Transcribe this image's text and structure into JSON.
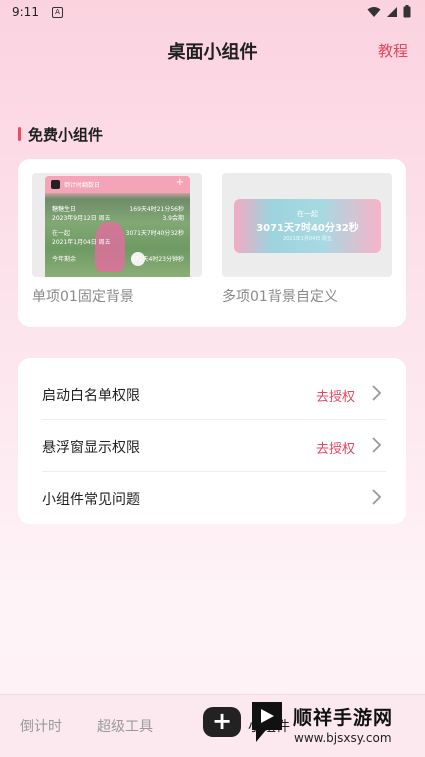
{
  "status_bar": {
    "time": "9:11",
    "notif_letter": "A"
  },
  "header": {
    "title": "桌面小组件",
    "tutorial_link": "教程"
  },
  "free_widgets": {
    "section_title": "免费小组件",
    "items": [
      {
        "label": "单项01固定背景",
        "preview": {
          "header_text": "倒计时翻数日",
          "row1_left": "糖糖生日",
          "row1_right": "169天4时21分56秒",
          "row1_sub": "2023年9月12日 周五",
          "row1_sub_r": "3.9会期",
          "row2_left": "在一起",
          "row2_right": "3071天7时40分32秒",
          "row2_sub": "2021年1月04日 周五",
          "row3_left": "今年剩余",
          "row3_right": "171天4时23分钟秒"
        }
      },
      {
        "label": "多项01背景自定义",
        "preview": {
          "title": "在一起",
          "counter": "3071天7时40分32秒",
          "date": "2021年1月04日 周五"
        }
      }
    ]
  },
  "permissions": [
    {
      "label": "启动白名单权限",
      "action": "去授权"
    },
    {
      "label": "悬浮窗显示权限",
      "action": "去授权"
    },
    {
      "label": "小组件常见问题",
      "action": ""
    }
  ],
  "bottom_nav": {
    "tab_countdown": "倒计时",
    "tab_super_tools": "超级工具",
    "tab_widgets": "小组件",
    "add_button": "+"
  },
  "watermark": {
    "title": "顺祥手游网",
    "url": "www.bjsxsy.com"
  },
  "colors": {
    "accent": "#e4475f",
    "background": "#fcdce7"
  }
}
